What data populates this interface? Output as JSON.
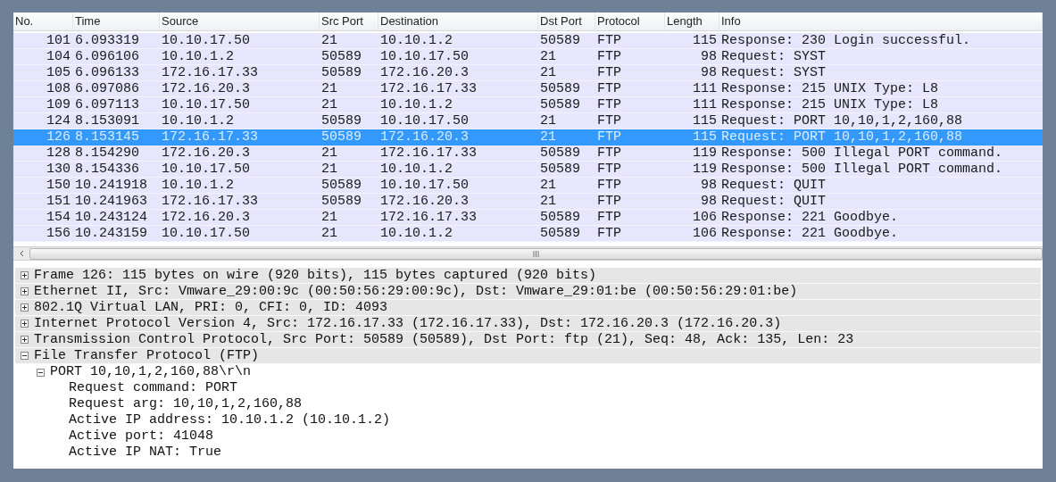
{
  "packet_list": {
    "columns": [
      "No.",
      "Time",
      "Source",
      "Src Port",
      "Destination",
      "Dst Port",
      "Protocol",
      "Length",
      "Info"
    ],
    "rows": [
      {
        "cells": [
          "101",
          "6.093319",
          "10.10.17.50",
          "21",
          "10.10.1.2",
          "50589",
          "FTP",
          "115",
          "Response: 230 Login successful."
        ],
        "selected": false
      },
      {
        "cells": [
          "104",
          "6.096106",
          "10.10.1.2",
          "50589",
          "10.10.17.50",
          "21",
          "FTP",
          "98",
          "Request: SYST"
        ],
        "selected": false
      },
      {
        "cells": [
          "105",
          "6.096133",
          "172.16.17.33",
          "50589",
          "172.16.20.3",
          "21",
          "FTP",
          "98",
          "Request: SYST"
        ],
        "selected": false
      },
      {
        "cells": [
          "108",
          "6.097086",
          "172.16.20.3",
          "21",
          "172.16.17.33",
          "50589",
          "FTP",
          "111",
          "Response: 215 UNIX Type: L8"
        ],
        "selected": false
      },
      {
        "cells": [
          "109",
          "6.097113",
          "10.10.17.50",
          "21",
          "10.10.1.2",
          "50589",
          "FTP",
          "111",
          "Response: 215 UNIX Type: L8"
        ],
        "selected": false
      },
      {
        "cells": [
          "124",
          "8.153091",
          "10.10.1.2",
          "50589",
          "10.10.17.50",
          "21",
          "FTP",
          "115",
          "Request: PORT 10,10,1,2,160,88"
        ],
        "selected": false
      },
      {
        "cells": [
          "126",
          "8.153145",
          "172.16.17.33",
          "50589",
          "172.16.20.3",
          "21",
          "FTP",
          "115",
          "Request: PORT 10,10,1,2,160,88"
        ],
        "selected": true
      },
      {
        "cells": [
          "128",
          "8.154290",
          "172.16.20.3",
          "21",
          "172.16.17.33",
          "50589",
          "FTP",
          "119",
          "Response: 500 Illegal PORT command."
        ],
        "selected": false
      },
      {
        "cells": [
          "130",
          "8.154336",
          "10.10.17.50",
          "21",
          "10.10.1.2",
          "50589",
          "FTP",
          "119",
          "Response: 500 Illegal PORT command."
        ],
        "selected": false
      },
      {
        "cells": [
          "150",
          "10.241918",
          "10.10.1.2",
          "50589",
          "10.10.17.50",
          "21",
          "FTP",
          "98",
          "Request: QUIT"
        ],
        "selected": false
      },
      {
        "cells": [
          "151",
          "10.241963",
          "172.16.17.33",
          "50589",
          "172.16.20.3",
          "21",
          "FTP",
          "98",
          "Request: QUIT"
        ],
        "selected": false
      },
      {
        "cells": [
          "154",
          "10.243124",
          "172.16.20.3",
          "21",
          "172.16.17.33",
          "50589",
          "FTP",
          "106",
          "Response: 221 Goodbye."
        ],
        "selected": false
      },
      {
        "cells": [
          "156",
          "10.243159",
          "10.10.17.50",
          "21",
          "10.10.1.2",
          "50589",
          "FTP",
          "106",
          "Response: 221 Goodbye."
        ],
        "selected": false
      }
    ]
  },
  "details": [
    {
      "label": "Frame 126: 115 bytes on wire (920 bits), 115 bytes captured (920 bits)",
      "expanded": false
    },
    {
      "label": "Ethernet II, Src: Vmware_29:00:9c (00:50:56:29:00:9c), Dst: Vmware_29:01:be (00:50:56:29:01:be)",
      "expanded": false
    },
    {
      "label": "802.1Q Virtual LAN, PRI: 0, CFI: 0, ID: 4093",
      "expanded": false
    },
    {
      "label": "Internet Protocol Version 4, Src: 172.16.17.33 (172.16.17.33), Dst: 172.16.20.3 (172.16.20.3)",
      "expanded": false
    },
    {
      "label": "Transmission Control Protocol, Src Port: 50589 (50589), Dst Port: ftp (21), Seq: 48, Ack: 135, Len: 23",
      "expanded": false
    },
    {
      "label": "File Transfer Protocol (FTP)",
      "expanded": true,
      "children": [
        {
          "label": "PORT 10,10,1,2,160,88\\r\\n",
          "expanded": true,
          "children": [
            {
              "label": "Request command: PORT"
            },
            {
              "label": "Request arg: 10,10,1,2,160,88"
            },
            {
              "label": "Active IP address: 10.10.1.2 (10.10.1.2)"
            },
            {
              "label": "Active port: 41048"
            },
            {
              "label": "Active IP NAT: True"
            }
          ]
        }
      ]
    }
  ]
}
